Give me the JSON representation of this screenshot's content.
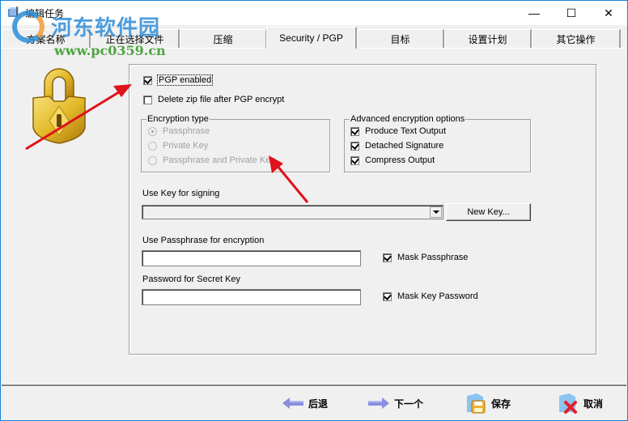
{
  "window": {
    "title": "编辑任务",
    "controls": {
      "minimize": "—",
      "maximize": "☐",
      "close": "✕"
    }
  },
  "watermark": {
    "site_name": "河东软件园",
    "url": "www.pc0359.cn"
  },
  "tabs": [
    {
      "label": "方案名称",
      "active": false
    },
    {
      "label": "正在选择文件",
      "active": false
    },
    {
      "label": "压缩",
      "active": false
    },
    {
      "label": "Security / PGP",
      "active": true
    },
    {
      "label": "目标",
      "active": false
    },
    {
      "label": "设置计划",
      "active": false
    },
    {
      "label": "其它操作",
      "active": false
    }
  ],
  "pgp": {
    "pgp_enabled": {
      "label": "PGP enabled",
      "checked": true
    },
    "delete_zip": {
      "label": "Delete zip file after PGP encrypt",
      "checked": false
    },
    "encryption_type": {
      "legend": "Encryption type",
      "options": [
        {
          "label": "Passphrase",
          "selected": true
        },
        {
          "label": "Private Key",
          "selected": false
        },
        {
          "label": "Passphrase and Private Key",
          "selected": false
        }
      ]
    },
    "advanced": {
      "legend": "Advanced encryption options",
      "options": [
        {
          "label": "Produce Text Output",
          "checked": true
        },
        {
          "label": "Detached Signature",
          "checked": true
        },
        {
          "label": "Compress Output",
          "checked": true
        }
      ]
    },
    "signing_key": {
      "label": "Use Key for signing",
      "value": "",
      "new_key_button": "New Key..."
    },
    "passphrase": {
      "label": "Use Passphrase for encryption",
      "value": "",
      "mask_label": "Mask Passphrase",
      "mask_checked": true
    },
    "secret_key_password": {
      "label": "Password for Secret Key",
      "value": "",
      "mask_label": "Mask Key Password",
      "mask_checked": true
    }
  },
  "footer": {
    "back": "后退",
    "next": "下一个",
    "save": "保存",
    "cancel": "取消"
  },
  "colors": {
    "accent": "#1883d7",
    "annotation_arrow": "#e0121a"
  }
}
